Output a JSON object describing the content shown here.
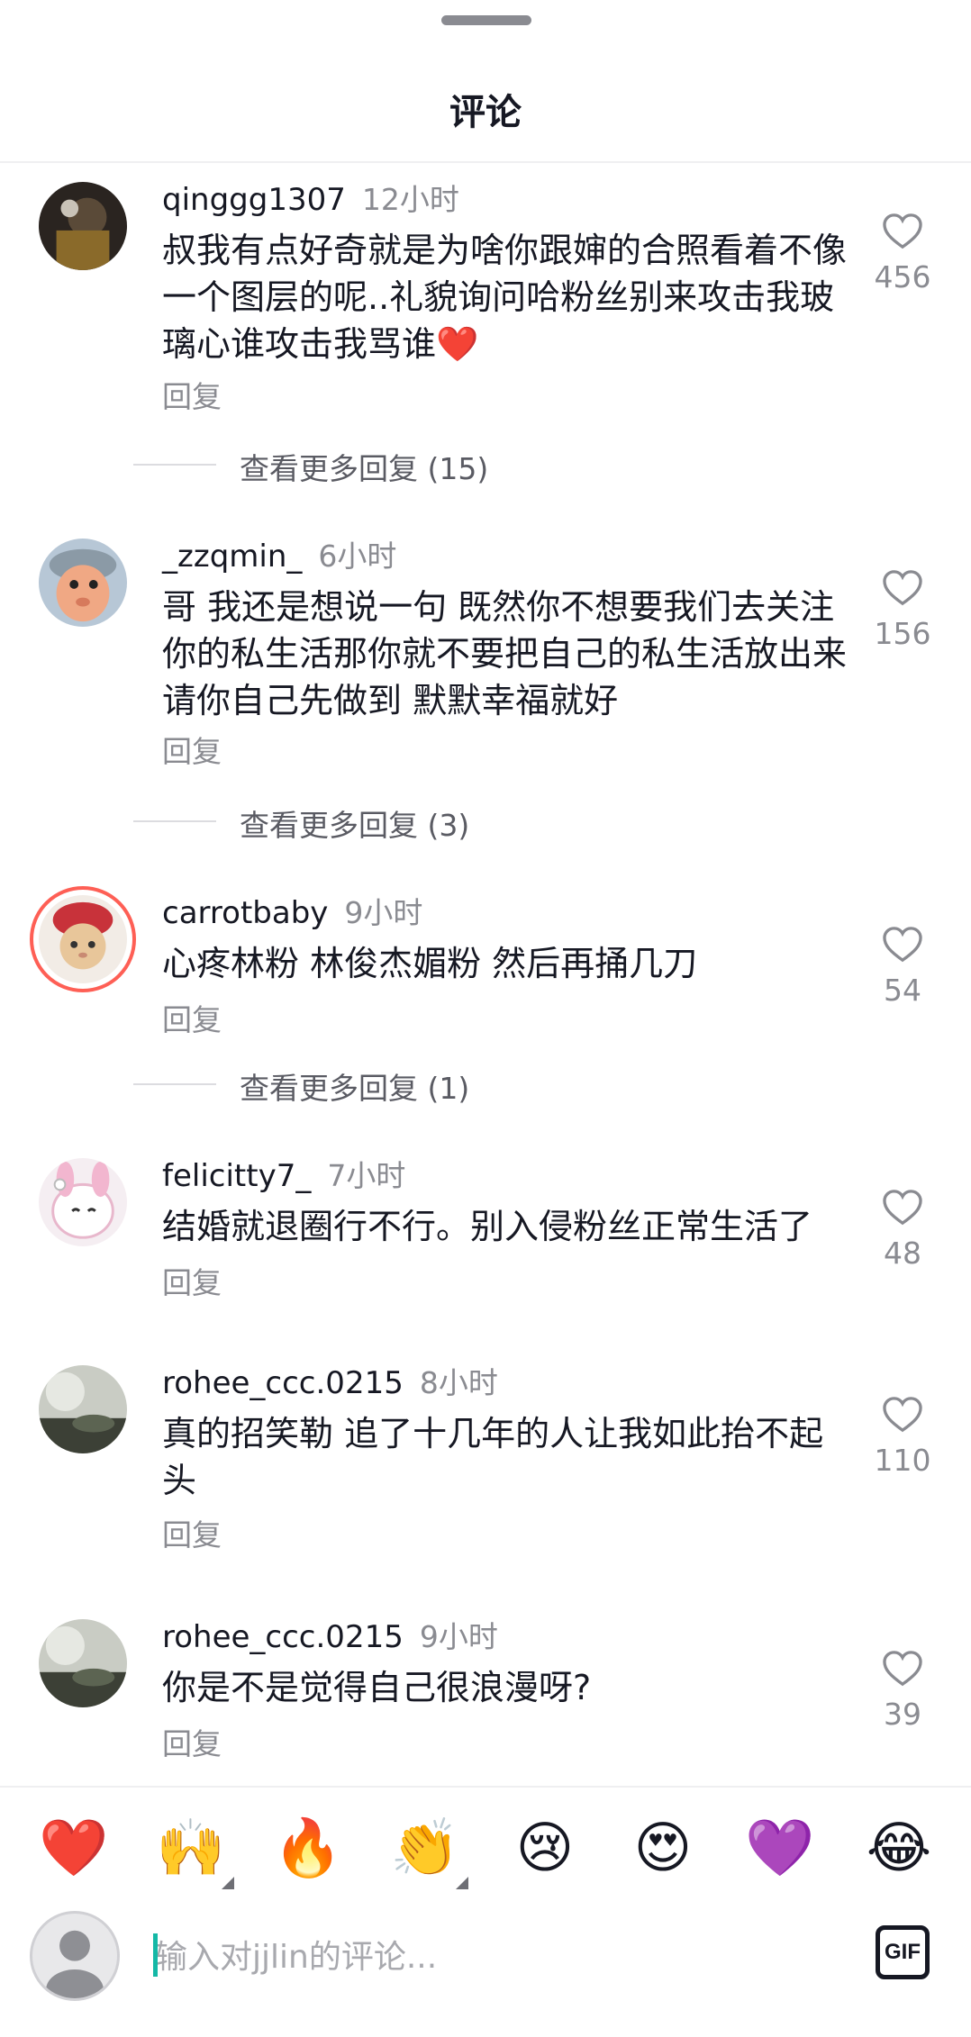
{
  "header": {
    "title": "评论"
  },
  "comments": [
    {
      "user": "qinggg1307",
      "time": "12小时",
      "text": "叔我有点好奇就是为啥你跟婶的合照看着不像一个图层的呢..礼貌询问哈粉丝别来攻击我玻璃心谁攻击我骂谁❤️",
      "reply": "回复",
      "likes": "456",
      "more_replies": "查看更多回复 (15)"
    },
    {
      "user": "_zzqmin_",
      "time": "6小时",
      "text": "哥 我还是想说一句 既然你不想要我们去关注你的私生活那你就不要把自己的私生活放出来 请你自己先做到 默默幸福就好",
      "reply": "回复",
      "likes": "156",
      "more_replies": "查看更多回复 (3)"
    },
    {
      "user": "carrotbaby",
      "time": "9小时",
      "text": "心疼林粉 林俊杰媚粉 然后再捅几刀",
      "reply": "回复",
      "likes": "54",
      "more_replies": "查看更多回复 (1)"
    },
    {
      "user": "felicitty7_",
      "time": "7小时",
      "text": "结婚就退圈行不行。别入侵粉丝正常生活了",
      "reply": "回复",
      "likes": "48"
    },
    {
      "user": "rohee_ccc.0215",
      "time": "8小时",
      "text": "真的招笑勒 追了十几年的人让我如此抬不起头",
      "reply": "回复",
      "likes": "110"
    },
    {
      "user": "rohee_ccc.0215",
      "time": "9小时",
      "text": "你是不是觉得自己很浪漫呀?",
      "reply": "回复",
      "likes": "39"
    }
  ],
  "emoji_bar": [
    "❤️",
    "🙌",
    "🔥",
    "👏",
    "😢",
    "😍",
    "💜",
    "😂"
  ],
  "input": {
    "placeholder": "输入对jjlin的评论...",
    "gif_label": "GIF"
  },
  "colors": {
    "accent_caret": "#14b8a6",
    "secondary_text": "#8a8b91",
    "ring": "#fe5f55"
  }
}
